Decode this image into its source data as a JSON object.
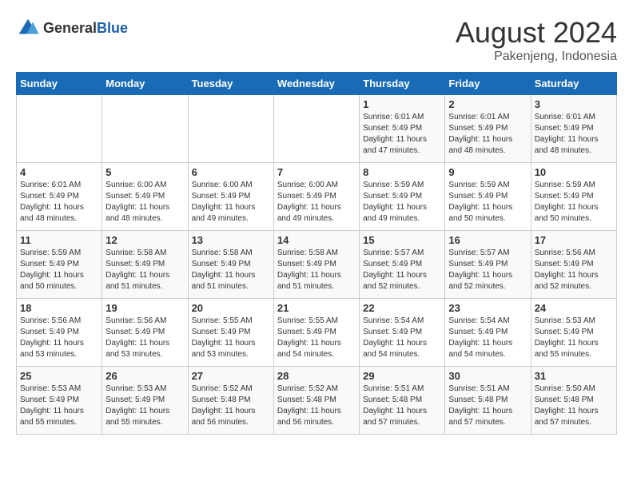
{
  "header": {
    "logo_general": "General",
    "logo_blue": "Blue",
    "month_title": "August 2024",
    "location": "Pakenjeng, Indonesia"
  },
  "weekdays": [
    "Sunday",
    "Monday",
    "Tuesday",
    "Wednesday",
    "Thursday",
    "Friday",
    "Saturday"
  ],
  "weeks": [
    [
      {
        "day": "",
        "info": ""
      },
      {
        "day": "",
        "info": ""
      },
      {
        "day": "",
        "info": ""
      },
      {
        "day": "",
        "info": ""
      },
      {
        "day": "1",
        "info": "Sunrise: 6:01 AM\nSunset: 5:49 PM\nDaylight: 11 hours\nand 47 minutes."
      },
      {
        "day": "2",
        "info": "Sunrise: 6:01 AM\nSunset: 5:49 PM\nDaylight: 11 hours\nand 48 minutes."
      },
      {
        "day": "3",
        "info": "Sunrise: 6:01 AM\nSunset: 5:49 PM\nDaylight: 11 hours\nand 48 minutes."
      }
    ],
    [
      {
        "day": "4",
        "info": "Sunrise: 6:01 AM\nSunset: 5:49 PM\nDaylight: 11 hours\nand 48 minutes."
      },
      {
        "day": "5",
        "info": "Sunrise: 6:00 AM\nSunset: 5:49 PM\nDaylight: 11 hours\nand 48 minutes."
      },
      {
        "day": "6",
        "info": "Sunrise: 6:00 AM\nSunset: 5:49 PM\nDaylight: 11 hours\nand 49 minutes."
      },
      {
        "day": "7",
        "info": "Sunrise: 6:00 AM\nSunset: 5:49 PM\nDaylight: 11 hours\nand 49 minutes."
      },
      {
        "day": "8",
        "info": "Sunrise: 5:59 AM\nSunset: 5:49 PM\nDaylight: 11 hours\nand 49 minutes."
      },
      {
        "day": "9",
        "info": "Sunrise: 5:59 AM\nSunset: 5:49 PM\nDaylight: 11 hours\nand 50 minutes."
      },
      {
        "day": "10",
        "info": "Sunrise: 5:59 AM\nSunset: 5:49 PM\nDaylight: 11 hours\nand 50 minutes."
      }
    ],
    [
      {
        "day": "11",
        "info": "Sunrise: 5:59 AM\nSunset: 5:49 PM\nDaylight: 11 hours\nand 50 minutes."
      },
      {
        "day": "12",
        "info": "Sunrise: 5:58 AM\nSunset: 5:49 PM\nDaylight: 11 hours\nand 51 minutes."
      },
      {
        "day": "13",
        "info": "Sunrise: 5:58 AM\nSunset: 5:49 PM\nDaylight: 11 hours\nand 51 minutes."
      },
      {
        "day": "14",
        "info": "Sunrise: 5:58 AM\nSunset: 5:49 PM\nDaylight: 11 hours\nand 51 minutes."
      },
      {
        "day": "15",
        "info": "Sunrise: 5:57 AM\nSunset: 5:49 PM\nDaylight: 11 hours\nand 52 minutes."
      },
      {
        "day": "16",
        "info": "Sunrise: 5:57 AM\nSunset: 5:49 PM\nDaylight: 11 hours\nand 52 minutes."
      },
      {
        "day": "17",
        "info": "Sunrise: 5:56 AM\nSunset: 5:49 PM\nDaylight: 11 hours\nand 52 minutes."
      }
    ],
    [
      {
        "day": "18",
        "info": "Sunrise: 5:56 AM\nSunset: 5:49 PM\nDaylight: 11 hours\nand 53 minutes."
      },
      {
        "day": "19",
        "info": "Sunrise: 5:56 AM\nSunset: 5:49 PM\nDaylight: 11 hours\nand 53 minutes."
      },
      {
        "day": "20",
        "info": "Sunrise: 5:55 AM\nSunset: 5:49 PM\nDaylight: 11 hours\nand 53 minutes."
      },
      {
        "day": "21",
        "info": "Sunrise: 5:55 AM\nSunset: 5:49 PM\nDaylight: 11 hours\nand 54 minutes."
      },
      {
        "day": "22",
        "info": "Sunrise: 5:54 AM\nSunset: 5:49 PM\nDaylight: 11 hours\nand 54 minutes."
      },
      {
        "day": "23",
        "info": "Sunrise: 5:54 AM\nSunset: 5:49 PM\nDaylight: 11 hours\nand 54 minutes."
      },
      {
        "day": "24",
        "info": "Sunrise: 5:53 AM\nSunset: 5:49 PM\nDaylight: 11 hours\nand 55 minutes."
      }
    ],
    [
      {
        "day": "25",
        "info": "Sunrise: 5:53 AM\nSunset: 5:49 PM\nDaylight: 11 hours\nand 55 minutes."
      },
      {
        "day": "26",
        "info": "Sunrise: 5:53 AM\nSunset: 5:49 PM\nDaylight: 11 hours\nand 55 minutes."
      },
      {
        "day": "27",
        "info": "Sunrise: 5:52 AM\nSunset: 5:48 PM\nDaylight: 11 hours\nand 56 minutes."
      },
      {
        "day": "28",
        "info": "Sunrise: 5:52 AM\nSunset: 5:48 PM\nDaylight: 11 hours\nand 56 minutes."
      },
      {
        "day": "29",
        "info": "Sunrise: 5:51 AM\nSunset: 5:48 PM\nDaylight: 11 hours\nand 57 minutes."
      },
      {
        "day": "30",
        "info": "Sunrise: 5:51 AM\nSunset: 5:48 PM\nDaylight: 11 hours\nand 57 minutes."
      },
      {
        "day": "31",
        "info": "Sunrise: 5:50 AM\nSunset: 5:48 PM\nDaylight: 11 hours\nand 57 minutes."
      }
    ]
  ]
}
